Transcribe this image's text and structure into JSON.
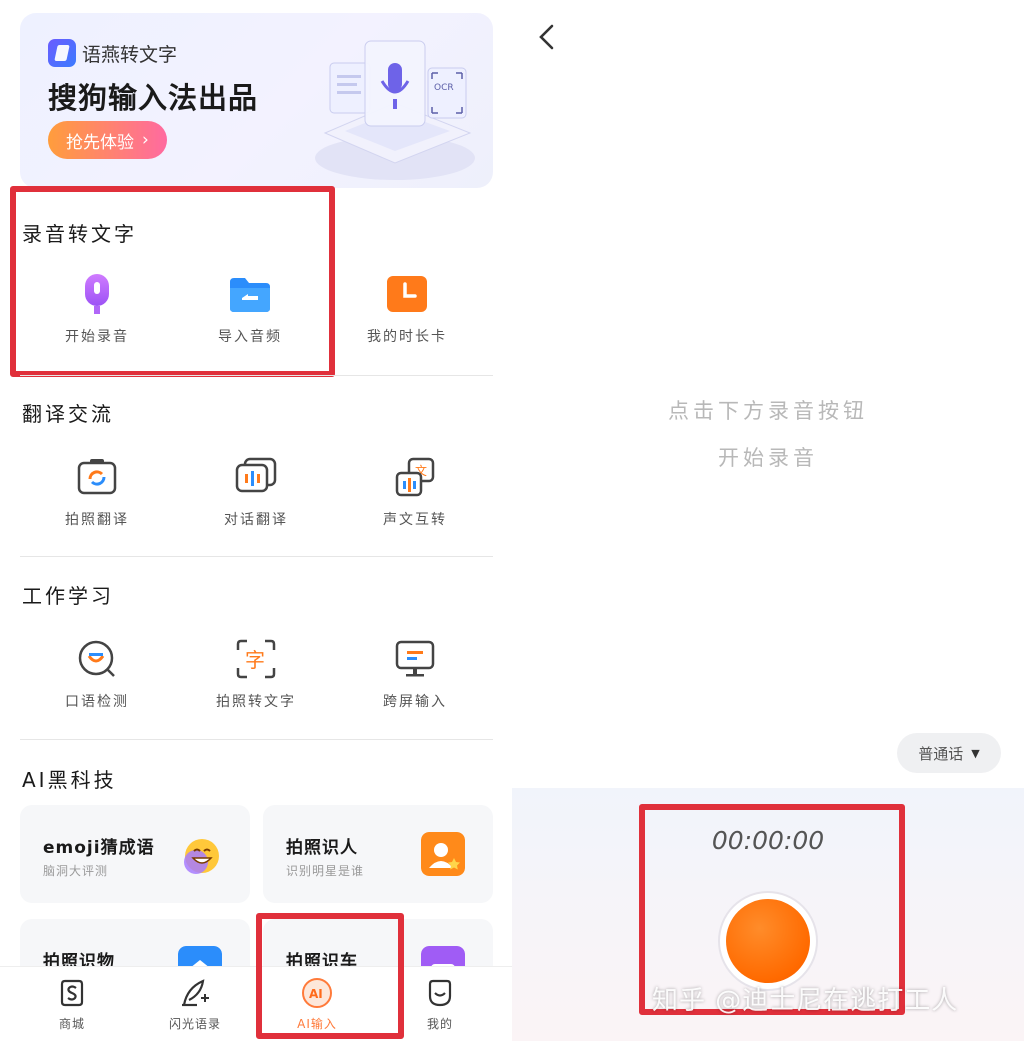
{
  "banner": {
    "brand_name": "语燕转文字",
    "headline": "搜狗输入法出品",
    "cta_label": "抢先体验",
    "illustration_text": "OCR"
  },
  "sections": {
    "recording": {
      "title": "录音转文字",
      "items": [
        {
          "label": "开始录音",
          "icon": "microphone-icon"
        },
        {
          "label": "导入音频",
          "icon": "folder-icon"
        },
        {
          "label": "我的时长卡",
          "icon": "clock-icon"
        }
      ]
    },
    "translate": {
      "title": "翻译交流",
      "items": [
        {
          "label": "拍照翻译",
          "icon": "camera-translate-icon"
        },
        {
          "label": "对话翻译",
          "icon": "chat-translate-icon"
        },
        {
          "label": "声文互转",
          "icon": "voice-text-icon"
        }
      ]
    },
    "work": {
      "title": "工作学习",
      "items": [
        {
          "label": "口语检测",
          "icon": "speech-check-icon"
        },
        {
          "label": "拍照转文字",
          "icon": "scan-text-icon"
        },
        {
          "label": "跨屏输入",
          "icon": "monitor-icon"
        }
      ]
    },
    "ai": {
      "title": "AI黑科技",
      "cards": [
        {
          "title": "emoji猜成语",
          "subtitle": "脑洞大评测",
          "icon": "emoji-icon"
        },
        {
          "title": "拍照识人",
          "subtitle": "识别明星是谁",
          "icon": "face-id-icon"
        },
        {
          "title": "拍照识物",
          "subtitle": "",
          "icon": "object-scan-icon"
        },
        {
          "title": "拍照识车",
          "subtitle": "",
          "icon": "car-scan-icon"
        }
      ]
    }
  },
  "tabbar": [
    {
      "label": "商城",
      "icon": "shop-icon",
      "active": false
    },
    {
      "label": "闪光语录",
      "icon": "quill-icon",
      "active": false
    },
    {
      "label": "AI输入",
      "icon": "ai-icon",
      "active": true,
      "icon_text": "AI"
    },
    {
      "label": "我的",
      "icon": "profile-icon",
      "active": false
    }
  ],
  "recorder": {
    "hint_line1": "点击下方录音按钮",
    "hint_line2": "开始录音",
    "language": "普通话",
    "timer": "00:00:00"
  },
  "watermark": "知乎 @迪士尼在逃打工人",
  "colors": {
    "accent_orange": "#ff6a00",
    "highlight_red": "#e0303b",
    "cta_gradient_start": "#ff9d3c",
    "cta_gradient_end": "#ff6aa0"
  }
}
